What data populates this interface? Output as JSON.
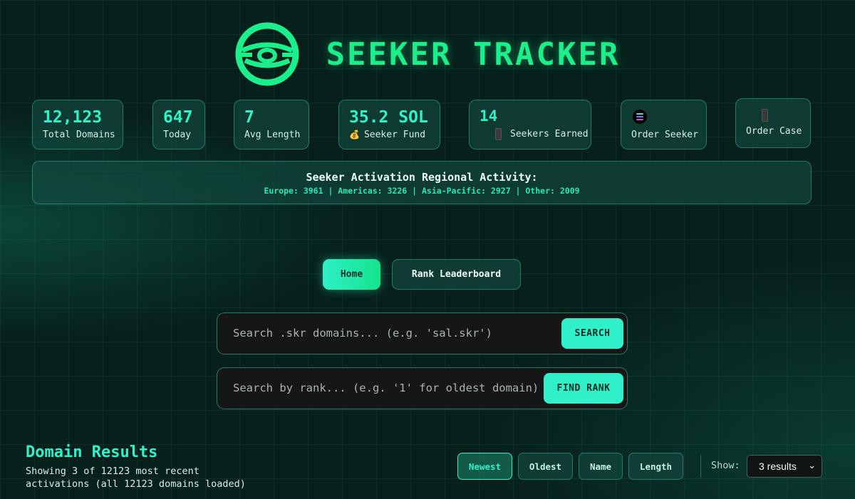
{
  "header": {
    "title": "SEEKER TRACKER",
    "logo_icon": "eye-logo-icon"
  },
  "stats": {
    "total_domains": {
      "value": "12,123",
      "label": "Total Domains"
    },
    "today": {
      "value": "647",
      "label": "Today"
    },
    "avg_length": {
      "value": "7",
      "label": "Avg Length"
    },
    "seeker_fund": {
      "value": "35.2 SOL",
      "label": "Seeker Fund",
      "icon": "money-bag-icon"
    },
    "seekers_earned": {
      "value": "14",
      "label": "Seekers Earned",
      "icon": "phone-icon"
    },
    "order_seeker": {
      "label": "Order Seeker",
      "icon": "solana-icon"
    },
    "order_case": {
      "label": "Order Case",
      "icon": "phone-case-icon"
    }
  },
  "region": {
    "title": "Seeker Activation Regional Activity:",
    "line": "Europe: 3961 | Americas: 3226 | Asia-Pacific: 2927 | Other: 2009"
  },
  "nav": {
    "home": "Home",
    "rank_leaderboard": "Rank Leaderboard"
  },
  "search": {
    "domain_placeholder": "Search .skr domains... (e.g. 'sal.skr')",
    "domain_button": "SEARCH",
    "rank_placeholder": "Search by rank... (e.g. '1' for oldest domain)",
    "rank_button": "FIND RANK"
  },
  "results": {
    "title": "Domain Results",
    "subtitle": "Showing 3 of 12123 most recent activations (all 12123 domains loaded)",
    "sort_options": [
      "Newest",
      "Oldest",
      "Name",
      "Length"
    ],
    "active_sort": "Newest",
    "show_label": "Show:",
    "show_value": "3 results"
  },
  "colors": {
    "accent": "#2ff2c9",
    "brand_green": "#19f08c",
    "background": "#07201c"
  }
}
